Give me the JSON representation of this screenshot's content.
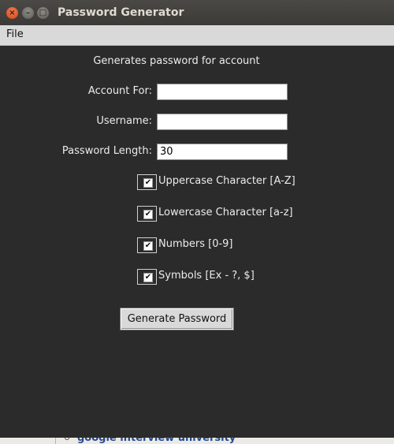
{
  "window": {
    "title": "Password Generator",
    "controls": {
      "close_glyph": "×",
      "minimize_glyph": "–",
      "maximize_glyph": "□"
    }
  },
  "menubar": {
    "file_label": "File"
  },
  "form": {
    "subtitle": "Generates password for account",
    "account_label": "Account For:",
    "account_value": "",
    "username_label": "Username:",
    "username_value": "",
    "length_label": "Password Length:",
    "length_value": "30"
  },
  "options": [
    {
      "label": "Uppercase Character [A-Z]",
      "checked": true
    },
    {
      "label": "Lowercase Character [a-z]",
      "checked": true
    },
    {
      "label": "Numbers [0-9]",
      "checked": true
    },
    {
      "label": "Symbols [Ex - ?, $]",
      "checked": true
    }
  ],
  "check_glyph": "✔",
  "generate_button_label": "Generate Password",
  "background_page": {
    "link_text": "google interview university"
  },
  "colors": {
    "window_bg": "#2b2b2b",
    "menubar_bg": "#d9d9d9",
    "close_button": "#e95420",
    "text": "#ececec"
  }
}
